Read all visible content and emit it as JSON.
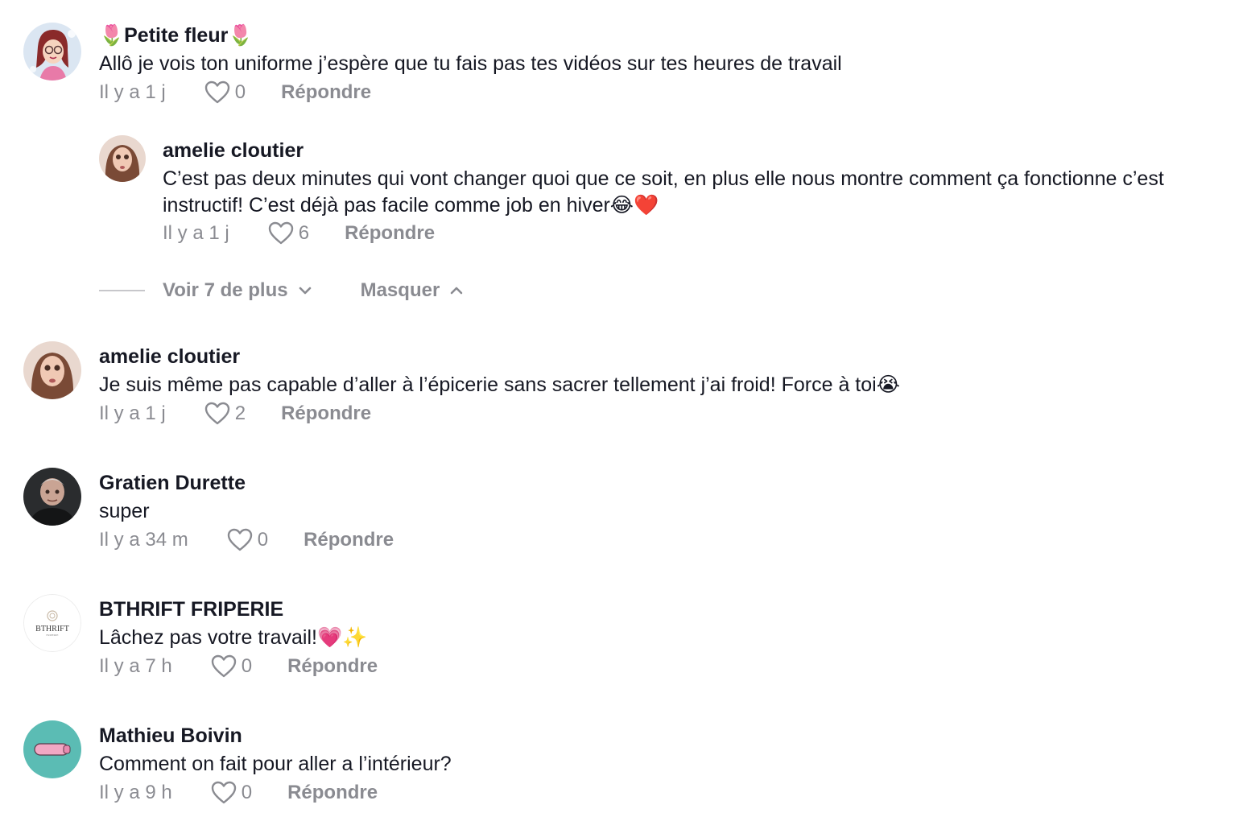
{
  "comments": [
    {
      "author": "🌷Petite fleur🌷",
      "text": "Allô je vois ton uniforme j’espère que tu fais pas tes vidéos sur tes heures de travail",
      "time": "Il y a 1 j",
      "likes": "0",
      "reply_label": "Répondre",
      "avatar": "cartoon-woman-glasses"
    },
    {
      "author": "amelie cloutier",
      "text": "C’est pas deux minutes qui vont changer quoi que ce soit, en plus elle nous montre comment ça fonctionne c’est instructif! C’est déjà pas facile comme job en hiver😂❤️",
      "time": "Il y a 1 j",
      "likes": "6",
      "reply_label": "Répondre",
      "avatar": "girl-photo"
    },
    {
      "author": "amelie cloutier",
      "text": "Je suis même pas capable d’aller à l’épicerie sans sacrer tellement j’ai froid! Force à toi😭",
      "time": "Il y a 1 j",
      "likes": "2",
      "reply_label": "Répondre",
      "avatar": "girl-photo"
    },
    {
      "author": "Gratien Durette",
      "text": "super",
      "time": "Il y a 34 m",
      "likes": "0",
      "reply_label": "Répondre",
      "avatar": "man-photo"
    },
    {
      "author": "BTHRIFT FRIPERIE",
      "text": "Lâchez pas votre travail!💗✨",
      "time": "Il y a 7 h",
      "likes": "0",
      "reply_label": "Répondre",
      "avatar": "bthrift-logo",
      "avatar_logo_text": "BTHRIFT",
      "avatar_logo_subtext": "FRIPERIE"
    },
    {
      "author": "Mathieu Boivin",
      "text": "Comment on fait pour aller a l’intérieur?",
      "time": "Il y a 9 h",
      "likes": "0",
      "reply_label": "Répondre",
      "avatar": "teal-pink-object"
    }
  ],
  "thread": {
    "view_more_label": "Voir 7 de plus",
    "view_more_icon": "chevron-down-icon",
    "hide_label": "Masquer",
    "hide_icon": "chevron-up-icon"
  },
  "colors": {
    "text": "#161823",
    "muted": "#8a8b91",
    "divider": "#c7c7cb"
  }
}
